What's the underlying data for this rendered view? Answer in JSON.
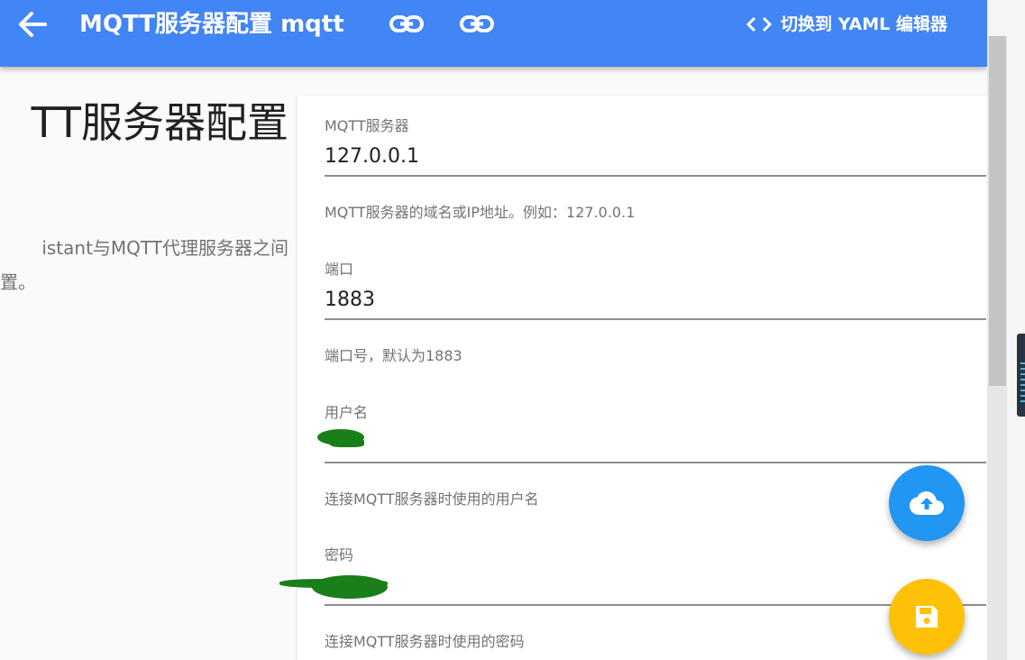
{
  "header": {
    "title": "MQTT服务器配置 mqtt",
    "yaml_button_label": "切换到 YAML 编辑器",
    "background": "#4285f4"
  },
  "intro": {
    "title": "TT服务器配置",
    "description_line1": "istant与MQTT代理服务器之间",
    "description_line2": "置。"
  },
  "form": {
    "fields": [
      {
        "label": "MQTT服务器",
        "value": "127.0.0.1",
        "help": "MQTT服务器的域名或IP地址。例如：127.0.0.1"
      },
      {
        "label": "端口",
        "value": "1883",
        "help": "端口号，默认为1883"
      },
      {
        "label": "用户名",
        "value": "",
        "help": "连接MQTT服务器时使用的用户名"
      },
      {
        "label": "密码",
        "value": "",
        "help": "连接MQTT服务器时使用的密码"
      }
    ]
  },
  "icons": {
    "back": "arrow-left-icon",
    "link": "link-icon",
    "code": "code-icon",
    "upload": "cloud-upload-icon",
    "save": "floppy-disk-icon"
  },
  "colors": {
    "primary": "#4285f4",
    "fab_upload": "#2196f3",
    "fab_save": "#ffc107",
    "redaction": "#1a7f1a"
  }
}
